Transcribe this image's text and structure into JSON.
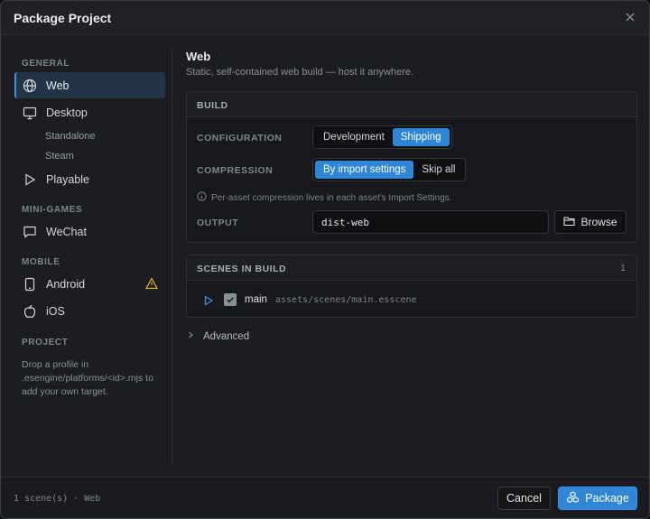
{
  "dialog": {
    "title": "Package Project"
  },
  "sidebar": {
    "general_header": "GENERAL",
    "minigames_header": "MINI-GAMES",
    "mobile_header": "MOBILE",
    "project_header": "PROJECT",
    "project_note": "Drop a profile in .esengine/platforms/<id>.mjs to add your own target.",
    "items": {
      "web": {
        "label": "Web",
        "icon": "globe-icon"
      },
      "desktop": {
        "label": "Desktop",
        "icon": "monitor-icon"
      },
      "standalone": {
        "label": "Standalone"
      },
      "steam": {
        "label": "Steam"
      },
      "playable": {
        "label": "Playable",
        "icon": "play-icon"
      },
      "wechat": {
        "label": "WeChat",
        "icon": "chat-icon"
      },
      "android": {
        "label": "Android",
        "icon": "phone-icon"
      },
      "ios": {
        "label": "iOS",
        "icon": "apple-icon"
      }
    }
  },
  "main": {
    "title": "Web",
    "subtitle": "Static, self-contained web build — host it anywhere.",
    "build": {
      "header": "BUILD",
      "configuration_label": "CONFIGURATION",
      "configuration_options": [
        "Development",
        "Shipping"
      ],
      "configuration_selected": "Shipping",
      "compression_label": "COMPRESSION",
      "compression_options": [
        "By import settings",
        "Skip all"
      ],
      "compression_selected": "By import settings",
      "compression_hint": "Per-asset compression lives in each asset's Import Settings.",
      "output_label": "OUTPUT",
      "output_value": "dist-web",
      "browse_label": "Browse"
    },
    "scenes": {
      "header": "SCENES IN BUILD",
      "count": "1",
      "items": [
        {
          "name": "main",
          "path": "assets/scenes/main.esscene",
          "checked": true
        }
      ]
    },
    "advanced_label": "Advanced"
  },
  "footer": {
    "status": "1 scene(s) · Web",
    "cancel_label": "Cancel",
    "package_label": "Package"
  },
  "colors": {
    "accent": "#2f86d6",
    "warning": "#e2b93b",
    "background": "#1c1d20"
  }
}
